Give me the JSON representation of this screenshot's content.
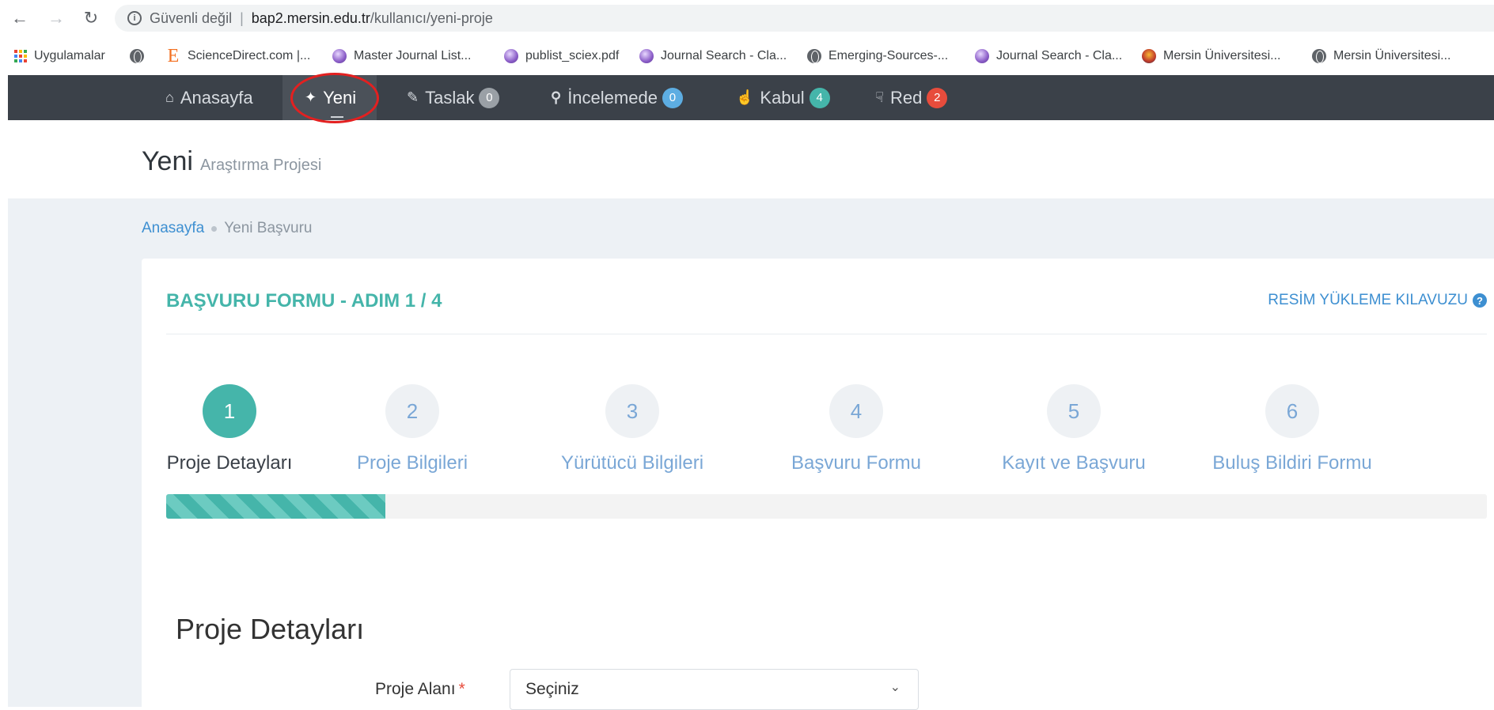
{
  "browser": {
    "security_text": "Güvenli değil",
    "url_host": "bap2.mersin.edu.tr",
    "url_path": "/kullanıcı/yeni-proje"
  },
  "bookmarks": [
    {
      "label": "Uygulamalar",
      "icon": "apps-grid-icon"
    },
    {
      "label": "",
      "icon": "globe-icon"
    },
    {
      "label": "ScienceDirect.com |...",
      "icon": "elsevier-e-icon"
    },
    {
      "label": "Master Journal List...",
      "icon": "clarivate-ball-icon"
    },
    {
      "label": "publist_sciex.pdf",
      "icon": "clarivate-ball-icon"
    },
    {
      "label": "Journal Search - Cla...",
      "icon": "clarivate-ball-icon"
    },
    {
      "label": "Emerging-Sources-...",
      "icon": "globe-icon"
    },
    {
      "label": "Journal Search - Cla...",
      "icon": "clarivate-ball-icon"
    },
    {
      "label": "Mersin Üniversitesi...",
      "icon": "mersin-logo-icon"
    },
    {
      "label": "Mersin Üniversitesi...",
      "icon": "globe-icon"
    }
  ],
  "nav": {
    "home": "Anasayfa",
    "new": "Yeni",
    "draft": "Taslak",
    "draft_count": "0",
    "review": "İncelemede",
    "review_count": "0",
    "accepted": "Kabul",
    "accepted_count": "4",
    "rejected": "Red",
    "rejected_count": "2"
  },
  "page": {
    "title": "Yeni",
    "subtitle": "Araştırma Projesi"
  },
  "breadcrumb": {
    "home": "Anasayfa",
    "current": "Yeni Başvuru"
  },
  "form": {
    "title": "BAŞVURU FORMU - ADIM 1 / 4",
    "guide_link": "RESİM YÜKLEME KILAVUZU",
    "progress_fraction": 0.166,
    "steps": [
      {
        "number": "1",
        "label": "Proje Detayları"
      },
      {
        "number": "2",
        "label": "Proje Bilgileri"
      },
      {
        "number": "3",
        "label": "Yürütücü Bilgileri"
      },
      {
        "number": "4",
        "label": "Başvuru Formu"
      },
      {
        "number": "5",
        "label": "Kayıt ve Başvuru"
      },
      {
        "number": "6",
        "label": "Buluş Bildiri Formu"
      }
    ],
    "section_title": "Proje Detayları",
    "field_label": "Proje Alanı",
    "required_mark": "*",
    "select_value": "Seçiniz"
  },
  "colors": {
    "accent": "#45b5aa",
    "link": "#3d8fd1",
    "nav_bg": "#3b4149",
    "highlight_circle": "#e32020"
  }
}
